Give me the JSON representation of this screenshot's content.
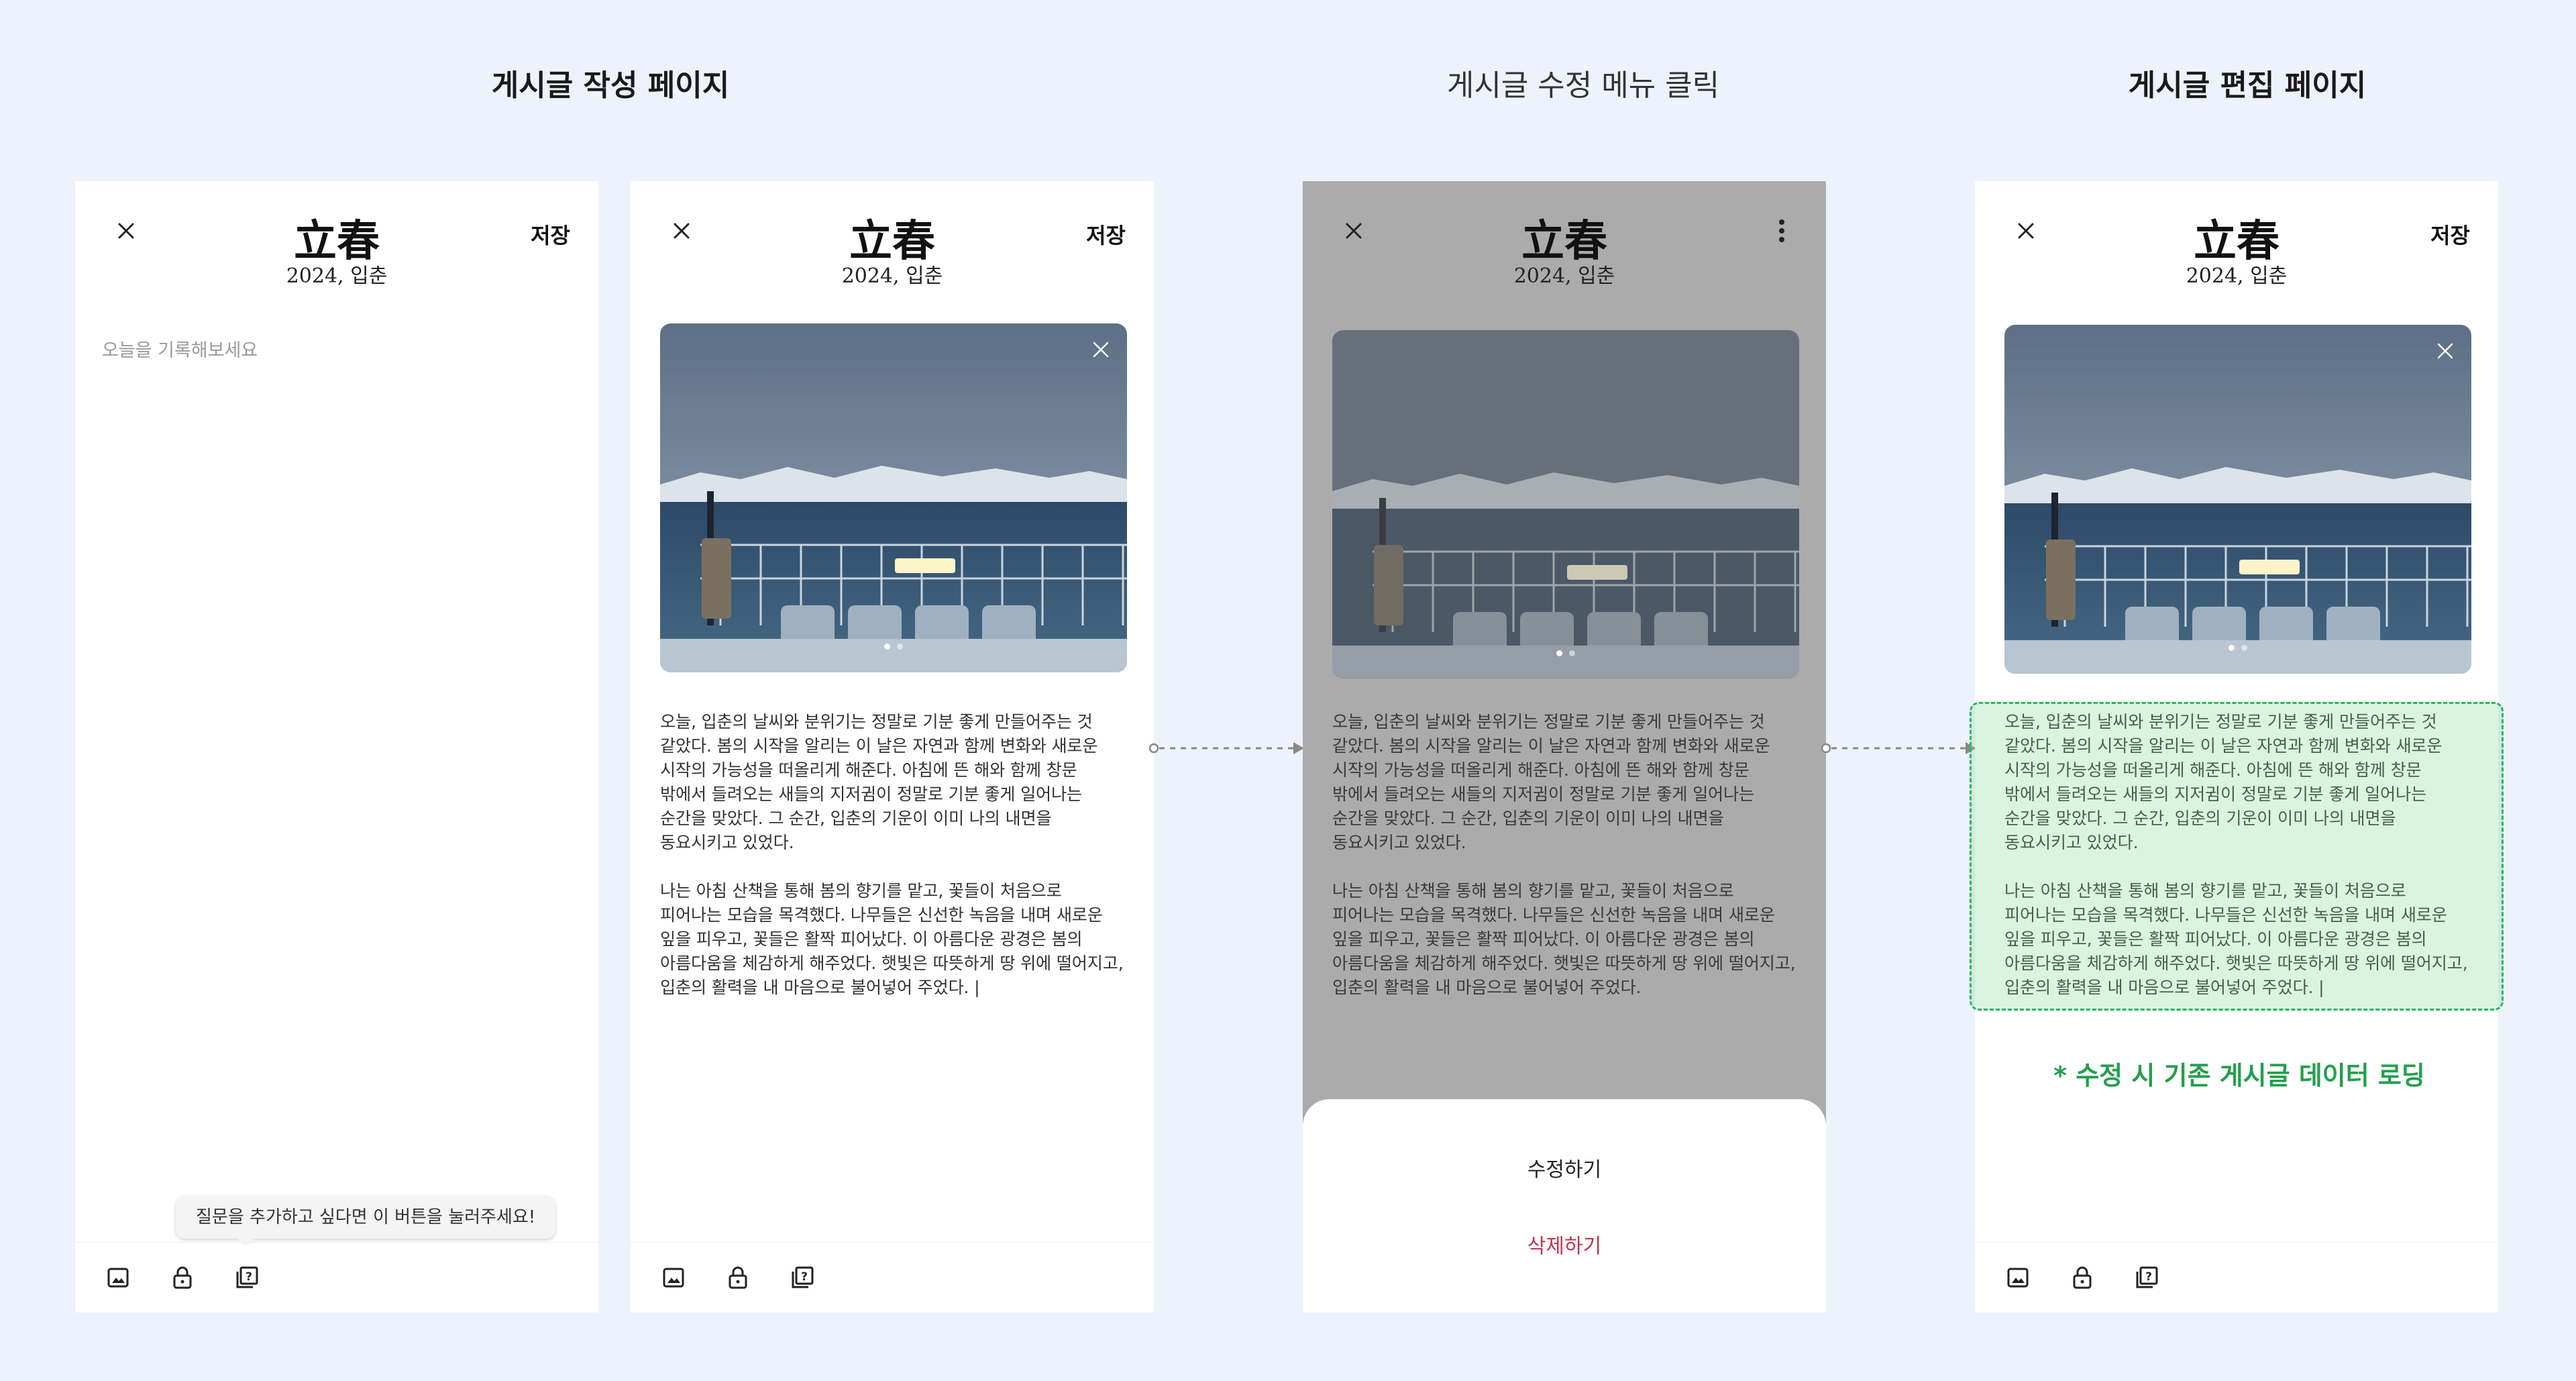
{
  "sections": {
    "write": "게시글 작성 페이지",
    "menu": "게시글 수정 메뉴 클릭",
    "edit": "게시글 편집 페이지"
  },
  "app": {
    "title": "立春",
    "subtitle": "2024, 입춘",
    "save_label": "저장"
  },
  "editor": {
    "placeholder": "오늘을 기록해보세요"
  },
  "tooltip": "질문을 추가하고 싶다면 이 버튼을 눌러주세요!",
  "post": {
    "p1": "오늘, 입춘의 날씨와 분위기는 정말로 기분 좋게 만들어주는 것 같았다. 봄의 시작을 알리는 이 날은 자연과 함께 변화와 새로운 시작의 가능성을 떠올리게 해준다. 아침에 뜬 해와 함께 창문 밖에서 들려오는 새들의 지저귐이 정말로 기분 좋게 일어나는 순간을 맞았다. 그 순간, 입춘의 기운이 이미 나의 내면을 동요시키고 있었다.",
    "p2": "나는 아침 산책을 통해 봄의 향기를 맡고, 꽃들이 처음으로 피어나는 모습을 목격했다. 나무들은 신선한 녹음을 내며 새로운 잎을 피우고, 꽃들은 활짝 피어났다. 이 아름다운 광경은 봄의 아름다움을 체감하게 해주었다. 햇빛은 따뜻하게 땅 위에 떨어지고, 입춘의 활력을 내 마음으로 불어넣어 주었다.",
    "cursor": "|"
  },
  "sheet": {
    "edit_label": "수정하기",
    "delete_label": "삭제하기"
  },
  "note": "* 수정 시 기존 게시글 데이터 로딩",
  "icons": [
    "close-icon",
    "more-vertical-icon",
    "image-icon",
    "lock-icon",
    "question-card-icon"
  ],
  "colors": {
    "background": "#eef2fd",
    "dim": "#ababab",
    "delete": "#c0334d",
    "highlight_border": "#2eb35a",
    "note": "#21a04b"
  }
}
